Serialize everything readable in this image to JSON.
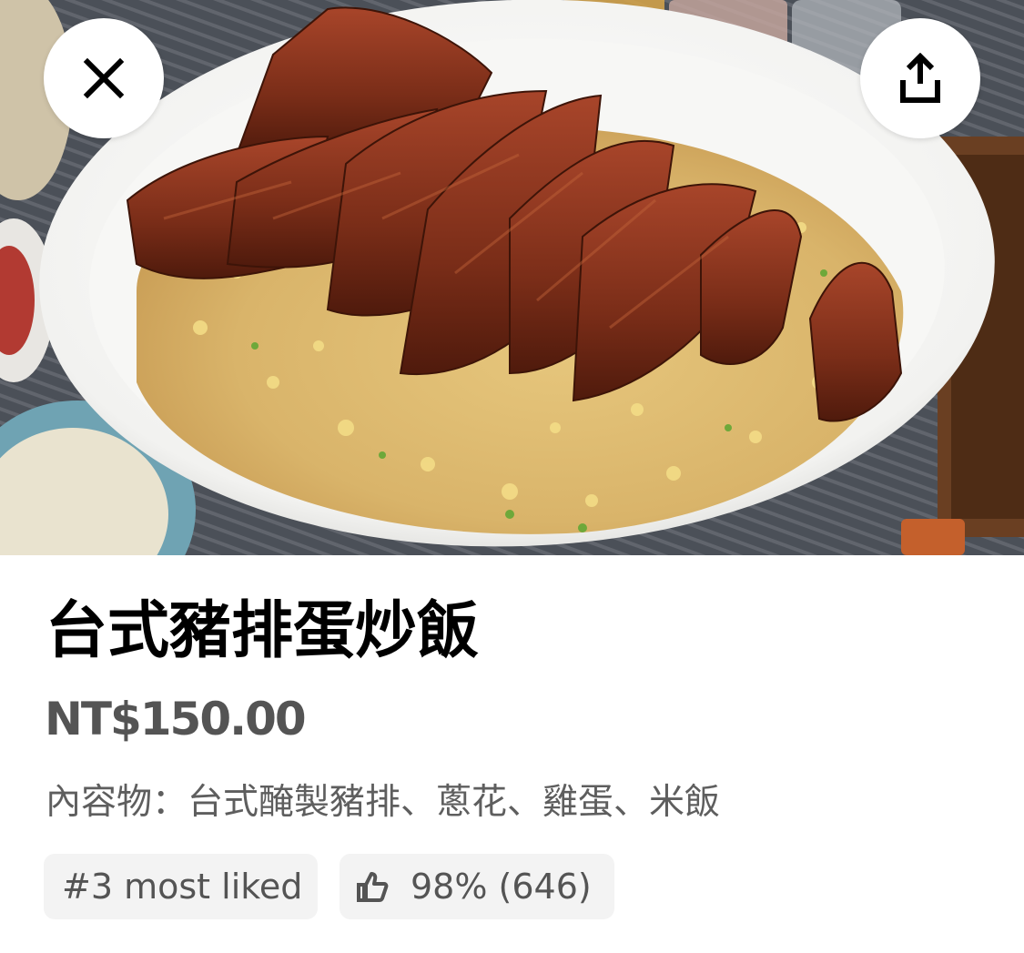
{
  "item": {
    "image_alt": "台式豬排蛋炒飯",
    "title": "台式豬排蛋炒飯",
    "price": "NT$150.00",
    "description": "內容物：台式醃製豬排、蔥花、雞蛋、米飯"
  },
  "header_buttons": {
    "close_icon": "close-icon",
    "share_icon": "share-icon"
  },
  "badges": {
    "rank_label": "#3 most liked",
    "rating_icon": "thumbs-up-icon",
    "rating_label": "98% (646)"
  },
  "colors": {
    "title": "#000000",
    "price": "#545454",
    "description": "#5e5e5e",
    "chip_background": "#f3f3f3"
  }
}
